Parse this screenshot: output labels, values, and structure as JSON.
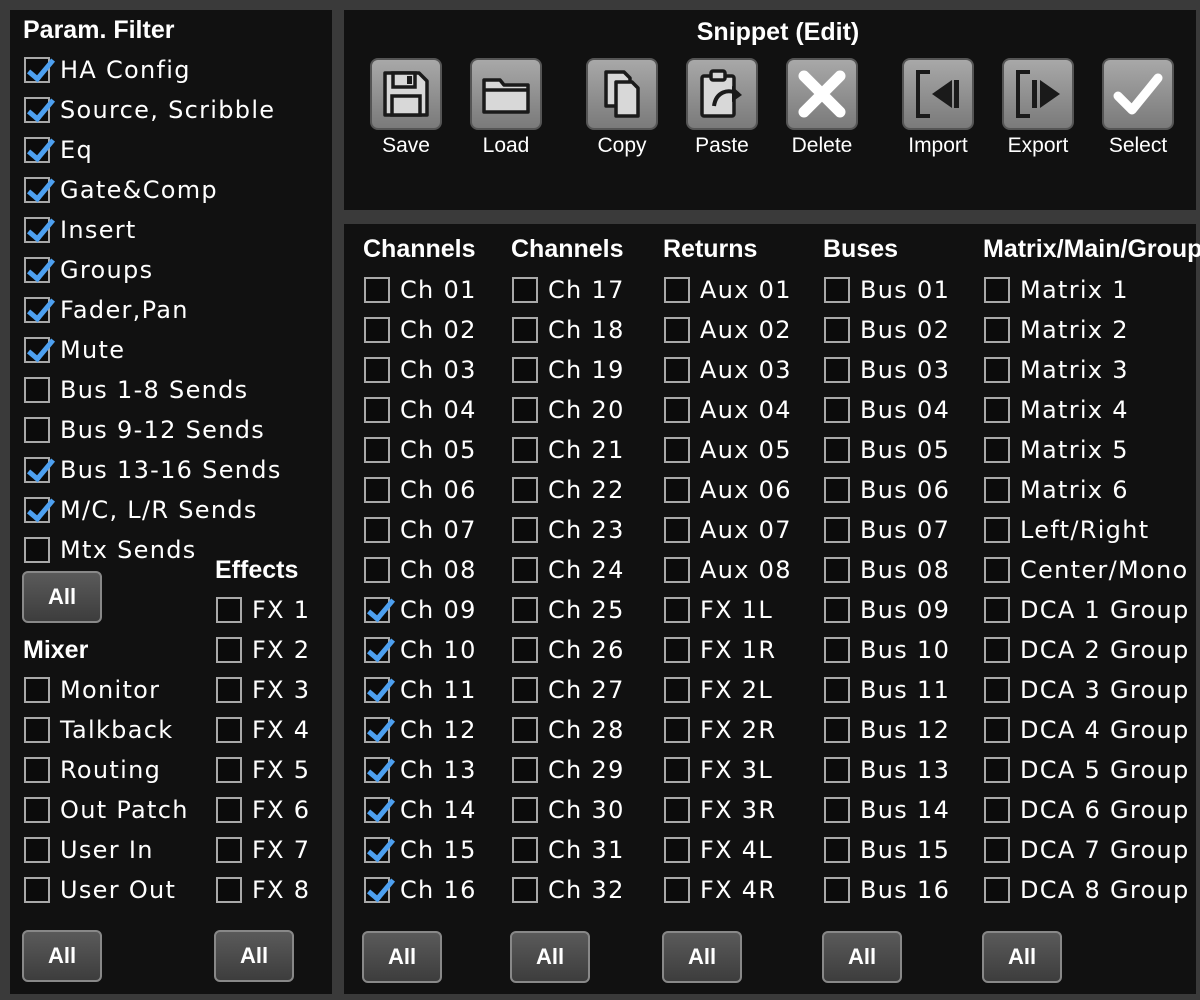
{
  "param_filter": {
    "title": "Param. Filter",
    "items": [
      {
        "label": "HA Config",
        "checked": true
      },
      {
        "label": "Source, Scribble",
        "checked": true
      },
      {
        "label": "Eq",
        "checked": true
      },
      {
        "label": "Gate&Comp",
        "checked": true
      },
      {
        "label": "Insert",
        "checked": true
      },
      {
        "label": "Groups",
        "checked": true
      },
      {
        "label": "Fader,Pan",
        "checked": true
      },
      {
        "label": "Mute",
        "checked": true
      },
      {
        "label": "Bus 1-8 Sends",
        "checked": false
      },
      {
        "label": "Bus 9-12 Sends",
        "checked": false
      },
      {
        "label": "Bus 13-16 Sends",
        "checked": true
      },
      {
        "label": "M/C, L/R Sends",
        "checked": true
      },
      {
        "label": "Mtx Sends",
        "checked": false
      }
    ],
    "all_label": "All"
  },
  "mixer": {
    "title": "Mixer",
    "items": [
      {
        "label": "Monitor",
        "checked": false
      },
      {
        "label": "Talkback",
        "checked": false
      },
      {
        "label": "Routing",
        "checked": false
      },
      {
        "label": "Out Patch",
        "checked": false
      },
      {
        "label": "User In",
        "checked": false
      },
      {
        "label": "User Out",
        "checked": false
      }
    ],
    "all_label": "All"
  },
  "effects": {
    "title": "Effects",
    "items": [
      {
        "label": "FX 1",
        "checked": false
      },
      {
        "label": "FX 2",
        "checked": false
      },
      {
        "label": "FX 3",
        "checked": false
      },
      {
        "label": "FX 4",
        "checked": false
      },
      {
        "label": "FX 5",
        "checked": false
      },
      {
        "label": "FX 6",
        "checked": false
      },
      {
        "label": "FX 7",
        "checked": false
      },
      {
        "label": "FX 8",
        "checked": false
      }
    ],
    "all_label": "All"
  },
  "snippet": {
    "title": "Snippet (Edit)",
    "tools": [
      {
        "label": "Save",
        "icon": "save-icon"
      },
      {
        "label": "Load",
        "icon": "folder-icon"
      },
      {
        "label": "Copy",
        "icon": "copy-icon"
      },
      {
        "label": "Paste",
        "icon": "paste-icon"
      },
      {
        "label": "Delete",
        "icon": "delete-icon"
      },
      {
        "label": "Import",
        "icon": "import-icon"
      },
      {
        "label": "Export",
        "icon": "export-icon"
      },
      {
        "label": "Select",
        "icon": "checkmark-icon"
      }
    ]
  },
  "columns": [
    {
      "id": "channels-1",
      "title": "Channels",
      "all_label": "All",
      "items": [
        {
          "label": "Ch 01",
          "checked": false
        },
        {
          "label": "Ch 02",
          "checked": false
        },
        {
          "label": "Ch 03",
          "checked": false
        },
        {
          "label": "Ch 04",
          "checked": false
        },
        {
          "label": "Ch 05",
          "checked": false
        },
        {
          "label": "Ch 06",
          "checked": false
        },
        {
          "label": "Ch 07",
          "checked": false
        },
        {
          "label": "Ch 08",
          "checked": false
        },
        {
          "label": "Ch 09",
          "checked": true
        },
        {
          "label": "Ch 10",
          "checked": true
        },
        {
          "label": "Ch 11",
          "checked": true
        },
        {
          "label": "Ch 12",
          "checked": true
        },
        {
          "label": "Ch 13",
          "checked": true
        },
        {
          "label": "Ch 14",
          "checked": true
        },
        {
          "label": "Ch 15",
          "checked": true
        },
        {
          "label": "Ch 16",
          "checked": true
        }
      ]
    },
    {
      "id": "channels-2",
      "title": "Channels",
      "all_label": "All",
      "items": [
        {
          "label": "Ch 17",
          "checked": false
        },
        {
          "label": "Ch 18",
          "checked": false
        },
        {
          "label": "Ch 19",
          "checked": false
        },
        {
          "label": "Ch 20",
          "checked": false
        },
        {
          "label": "Ch 21",
          "checked": false
        },
        {
          "label": "Ch 22",
          "checked": false
        },
        {
          "label": "Ch 23",
          "checked": false
        },
        {
          "label": "Ch 24",
          "checked": false
        },
        {
          "label": "Ch 25",
          "checked": false
        },
        {
          "label": "Ch 26",
          "checked": false
        },
        {
          "label": "Ch 27",
          "checked": false
        },
        {
          "label": "Ch 28",
          "checked": false
        },
        {
          "label": "Ch 29",
          "checked": false
        },
        {
          "label": "Ch 30",
          "checked": false
        },
        {
          "label": "Ch 31",
          "checked": false
        },
        {
          "label": "Ch 32",
          "checked": false
        }
      ]
    },
    {
      "id": "returns",
      "title": "Returns",
      "all_label": "All",
      "items": [
        {
          "label": "Aux 01",
          "checked": false
        },
        {
          "label": "Aux 02",
          "checked": false
        },
        {
          "label": "Aux 03",
          "checked": false
        },
        {
          "label": "Aux 04",
          "checked": false
        },
        {
          "label": "Aux 05",
          "checked": false
        },
        {
          "label": "Aux 06",
          "checked": false
        },
        {
          "label": "Aux 07",
          "checked": false
        },
        {
          "label": "Aux 08",
          "checked": false
        },
        {
          "label": "FX 1L",
          "checked": false
        },
        {
          "label": "FX 1R",
          "checked": false
        },
        {
          "label": "FX 2L",
          "checked": false
        },
        {
          "label": "FX 2R",
          "checked": false
        },
        {
          "label": "FX 3L",
          "checked": false
        },
        {
          "label": "FX 3R",
          "checked": false
        },
        {
          "label": "FX 4L",
          "checked": false
        },
        {
          "label": "FX 4R",
          "checked": false
        }
      ]
    },
    {
      "id": "buses",
      "title": "Buses",
      "all_label": "All",
      "items": [
        {
          "label": "Bus 01",
          "checked": false
        },
        {
          "label": "Bus 02",
          "checked": false
        },
        {
          "label": "Bus 03",
          "checked": false
        },
        {
          "label": "Bus 04",
          "checked": false
        },
        {
          "label": "Bus 05",
          "checked": false
        },
        {
          "label": "Bus 06",
          "checked": false
        },
        {
          "label": "Bus 07",
          "checked": false
        },
        {
          "label": "Bus 08",
          "checked": false
        },
        {
          "label": "Bus 09",
          "checked": false
        },
        {
          "label": "Bus 10",
          "checked": false
        },
        {
          "label": "Bus 11",
          "checked": false
        },
        {
          "label": "Bus 12",
          "checked": false
        },
        {
          "label": "Bus 13",
          "checked": false
        },
        {
          "label": "Bus 14",
          "checked": false
        },
        {
          "label": "Bus 15",
          "checked": false
        },
        {
          "label": "Bus 16",
          "checked": false
        }
      ]
    },
    {
      "id": "matrix",
      "title": "Matrix/Main/Group",
      "all_label": "All",
      "items": [
        {
          "label": "Matrix 1",
          "checked": false
        },
        {
          "label": "Matrix 2",
          "checked": false
        },
        {
          "label": "Matrix 3",
          "checked": false
        },
        {
          "label": "Matrix 4",
          "checked": false
        },
        {
          "label": "Matrix 5",
          "checked": false
        },
        {
          "label": "Matrix 6",
          "checked": false
        },
        {
          "label": "Left/Right",
          "checked": false
        },
        {
          "label": "Center/Mono",
          "checked": false
        },
        {
          "label": "DCA 1 Group",
          "checked": false
        },
        {
          "label": "DCA 2 Group",
          "checked": false
        },
        {
          "label": "DCA 3 Group",
          "checked": false
        },
        {
          "label": "DCA 4 Group",
          "checked": false
        },
        {
          "label": "DCA 5 Group",
          "checked": false
        },
        {
          "label": "DCA 6 Group",
          "checked": false
        },
        {
          "label": "DCA 7 Group",
          "checked": false
        },
        {
          "label": "DCA 8 Group",
          "checked": false
        }
      ]
    }
  ],
  "colors": {
    "check": "#4da0f0",
    "panel": "#111111",
    "background": "#3a3a3a"
  }
}
